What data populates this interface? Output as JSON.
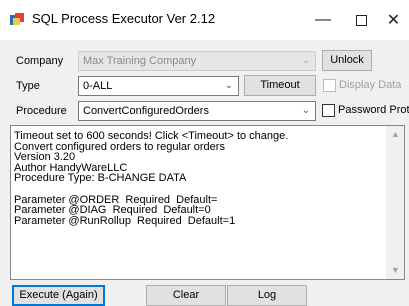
{
  "window": {
    "title": "SQL Process Executor Ver 2.12",
    "minimize_glyph": "—",
    "close_glyph": "✕"
  },
  "form": {
    "company_label": "Company",
    "company_value": "Max Training Company",
    "unlock_label": "Unlock",
    "type_label": "Type",
    "type_value": "0-ALL",
    "timeout_label": "Timeout",
    "display_data_label": "Display Data",
    "procedure_label": "Procedure",
    "procedure_value": "ConvertConfiguredOrders",
    "password_protect_label": "Password Protect"
  },
  "log": {
    "lines": [
      "Timeout set to 600 seconds! Click <Timeout> to change.",
      "Convert configured orders to regular orders",
      "Version 3.20",
      "Author HandyWareLLC",
      "Procedure Type: B-CHANGE DATA",
      "",
      "Parameter @ORDER  Required  Default=",
      "Parameter @DIAG  Required  Default=0",
      "Parameter @RunRollup  Required  Default=1"
    ]
  },
  "buttons": {
    "execute_label": "Execute (Again)",
    "clear_label": "Clear",
    "log_label": "Log"
  },
  "icons": {
    "app": "sql-app-icon",
    "combo_arrow": "chevron-down-icon",
    "scroll_up": "scroll-up-icon",
    "scroll_down": "scroll-down-icon"
  },
  "colors": {
    "accent": "#0078d7",
    "window_bg": "#f0f0f0",
    "disabled_text": "#8a8a8a"
  }
}
